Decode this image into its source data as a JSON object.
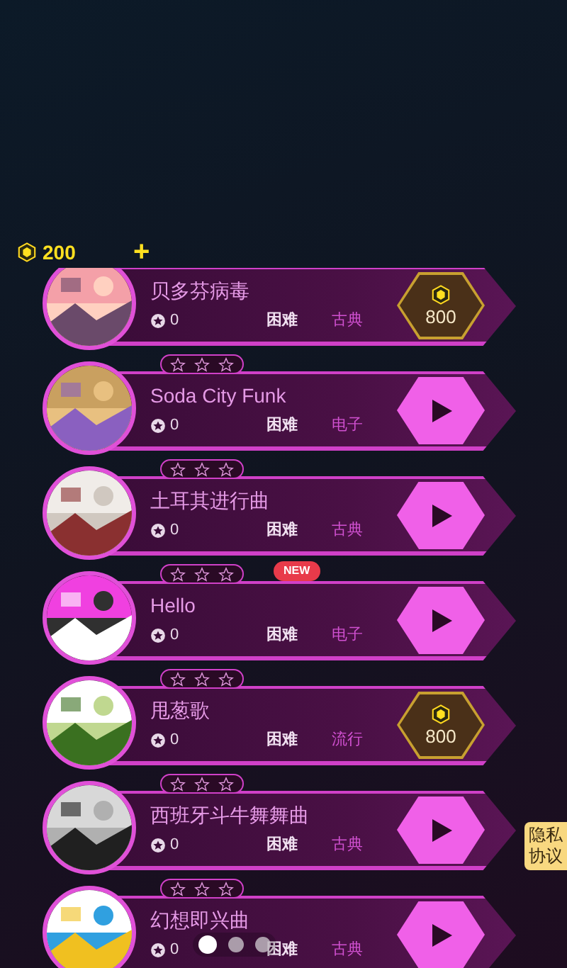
{
  "wallet": {
    "coins": "200",
    "add": "+"
  },
  "songs": [
    {
      "title": "贝多芬病毒",
      "score": "0",
      "difficulty": "困难",
      "genre": "古典",
      "action": {
        "kind": "price",
        "price": "800"
      }
    },
    {
      "title": "Soda City Funk",
      "stars": 0,
      "score": "0",
      "difficulty": "困难",
      "genre": "电子",
      "action": {
        "kind": "play"
      }
    },
    {
      "title": "土耳其进行曲",
      "stars": 0,
      "score": "0",
      "difficulty": "困难",
      "genre": "古典",
      "action": {
        "kind": "play"
      }
    },
    {
      "title": "Hello",
      "stars": 0,
      "score": "0",
      "difficulty": "困难",
      "genre": "电子",
      "badge": "NEW",
      "action": {
        "kind": "play"
      }
    },
    {
      "title": "甩葱歌",
      "stars": 0,
      "score": "0",
      "difficulty": "困难",
      "genre": "流行",
      "action": {
        "kind": "price",
        "price": "800"
      }
    },
    {
      "title": "西班牙斗牛舞舞曲",
      "stars": 0,
      "score": "0",
      "difficulty": "困难",
      "genre": "古典",
      "action": {
        "kind": "play"
      }
    },
    {
      "title": "幻想即兴曲",
      "stars": 0,
      "score": "0",
      "difficulty": "困难",
      "genre": "古典",
      "action": {
        "kind": "play"
      }
    }
  ],
  "pager": [
    {
      "selected": true
    },
    {
      "selected": false
    },
    {
      "selected": false
    }
  ],
  "privacy_tab": "隐私协议"
}
